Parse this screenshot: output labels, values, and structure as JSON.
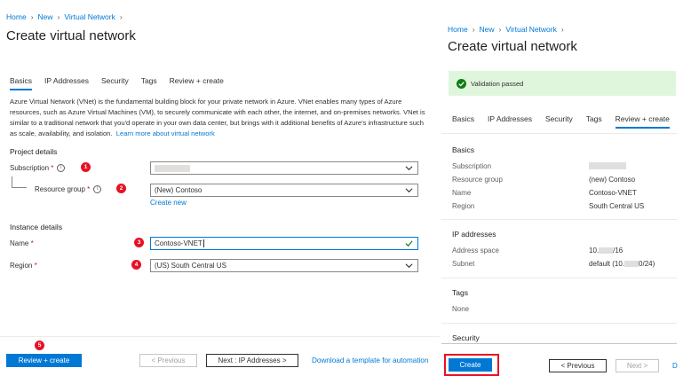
{
  "left": {
    "breadcrumb": [
      "Home",
      "New",
      "Virtual Network"
    ],
    "title": "Create virtual network",
    "tabs": [
      "Basics",
      "IP Addresses",
      "Security",
      "Tags",
      "Review + create"
    ],
    "active_tab": "Basics",
    "description": "Azure Virtual Network (VNet) is the fundamental building block for your private network in Azure. VNet enables many types of Azure resources, such as Azure Virtual Machines (VM), to securely communicate with each other, the internet, and on-premises networks. VNet is similar to a traditional network that you'd operate in your own data center, but brings with it additional benefits of Azure's infrastructure such as scale, availability, and isolation.",
    "learn_more": "Learn more about virtual network",
    "project_details": "Project details",
    "subscription_label": "Subscription",
    "resource_group_label": "Resource group",
    "resource_group_value": "(New) Contoso",
    "create_new": "Create new",
    "instance_details": "Instance details",
    "name_label": "Name",
    "name_value": "Contoso-VNET",
    "region_label": "Region",
    "region_value": "(US) South Central US",
    "required_mark": "*",
    "info_glyph": "i",
    "badges": [
      "1",
      "2",
      "3",
      "4",
      "5"
    ],
    "buttons": {
      "review_create": "Review + create",
      "previous": "< Previous",
      "next": "Next : IP Addresses >",
      "download": "Download a template for automation"
    }
  },
  "right": {
    "breadcrumb": [
      "Home",
      "New",
      "Virtual Network"
    ],
    "title": "Create virtual network",
    "validation": "Validation passed",
    "tabs": [
      "Basics",
      "IP Addresses",
      "Security",
      "Tags",
      "Review + create"
    ],
    "active_tab": "Review + create",
    "basics": {
      "heading": "Basics",
      "rows": [
        {
          "label": "Subscription",
          "value": ""
        },
        {
          "label": "Resource group",
          "value": "(new) Contoso"
        },
        {
          "label": "Name",
          "value": "Contoso-VNET"
        },
        {
          "label": "Region",
          "value": "South Central US"
        }
      ]
    },
    "ip": {
      "heading": "IP addresses",
      "address_space_label": "Address space",
      "address_space_prefix": "10.",
      "address_space_suffix": "/16",
      "subnet_label": "Subnet",
      "subnet_prefix": "default (10.",
      "subnet_suffix": "0/24)"
    },
    "tags": {
      "heading": "Tags",
      "value": "None"
    },
    "security": {
      "heading": "Security"
    },
    "buttons": {
      "create": "Create",
      "previous": "< Previous",
      "next": "Next >",
      "cut_link": "D"
    }
  },
  "colors": {
    "accent": "#0078d4",
    "badge": "#e81123",
    "success": "#107c10",
    "success_bg": "#dff6dd",
    "highlight_box": "#e81123"
  },
  "icons": {
    "breadcrumb_separator": "chevron-right-icon",
    "dropdown": "chevron-down-icon",
    "valid": "checkmark-icon",
    "validation": "success-circle-icon",
    "info": "info-icon"
  }
}
